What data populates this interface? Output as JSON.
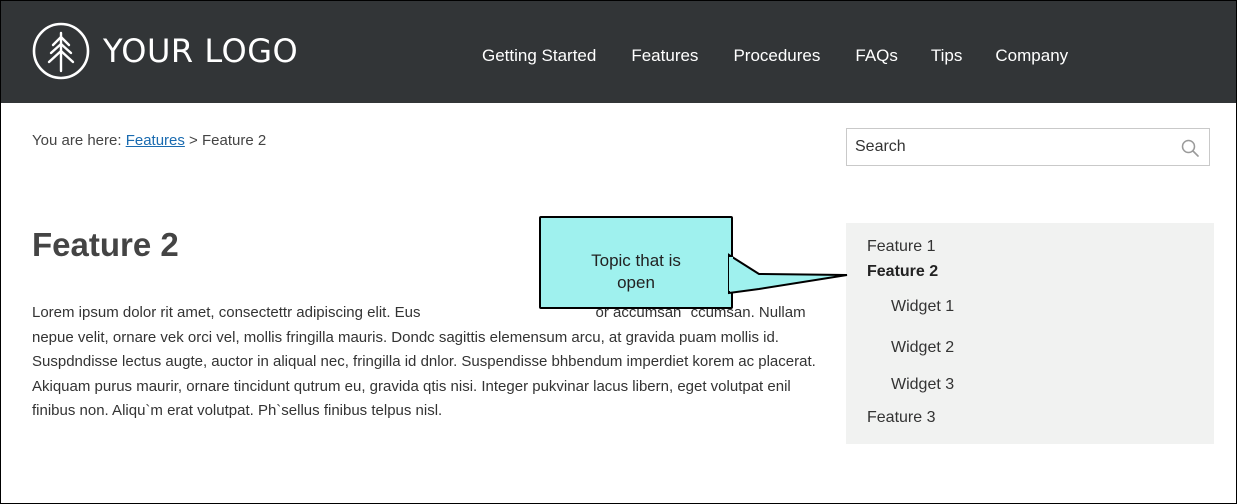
{
  "header": {
    "logo_text": "YOUR LOGO",
    "nav": [
      {
        "label": "Getting Started"
      },
      {
        "label": "Features"
      },
      {
        "label": "Procedures"
      },
      {
        "label": "FAQs"
      },
      {
        "label": "Tips"
      },
      {
        "label": "Company"
      }
    ]
  },
  "breadcrumb": {
    "prefix": "You are here: ",
    "link": "Features",
    "separator": " > ",
    "current": "Feature 2"
  },
  "search": {
    "placeholder": "Search"
  },
  "main": {
    "title": "Feature 2",
    "body": "Lorem ipsum dolor rit amet, consectettr adipiscing elit. Eus                                          or accumsan `ccumsan. Nullam nepue velit, ornare vek orci vel, mollis fringilla mauris. Dondc sagittis elemensum arcu, at gravida puam mollis id. Suspdndisse lectus augte, auctor in aliqual nec, fringilla id dnlor. Suspendisse bhbendum imperdiet korem ac placerat. Akiquam purus maurir, ornare tincidunt qutrum eu, gravida qtis nisi. Integer pukvinar lacus libern, eget volutpat enil finibus non. Aliqu`m erat volutpat. Ph`sellus finibus telpus nisl."
  },
  "sidenav": {
    "items": [
      {
        "label": "Feature 1"
      },
      {
        "label": "Feature 2"
      },
      {
        "label": "Widget 1"
      },
      {
        "label": "Widget 2"
      },
      {
        "label": "Widget 3"
      },
      {
        "label": "Feature 3"
      }
    ]
  },
  "callout": {
    "line1": "Topic that is",
    "line2": "open"
  },
  "colors": {
    "header_bg": "#323537",
    "callout_bg": "#9ff1ee",
    "link": "#1a6bb0",
    "sidenav_bg": "#f1f2f1"
  },
  "icons": {
    "logo": "tree-circle-icon",
    "search": "search-icon"
  }
}
